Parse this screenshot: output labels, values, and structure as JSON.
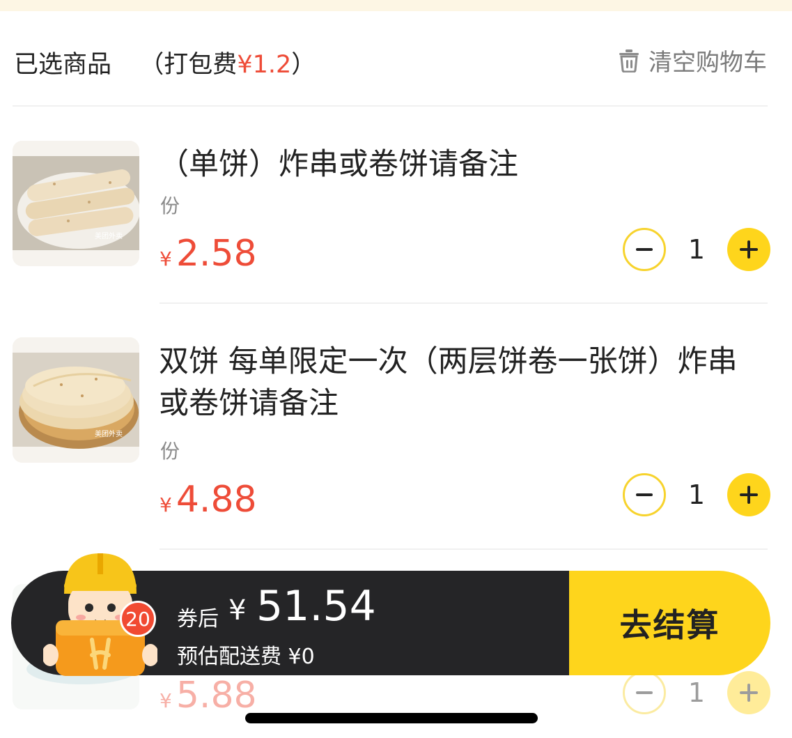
{
  "header": {
    "title": "已选商品",
    "packing_fee_prefix": "（打包费",
    "packing_fee_value": "¥1.2",
    "packing_fee_suffix": "）",
    "clear_cart_label": "清空购物车"
  },
  "items": [
    {
      "name": "（单饼）炸串或卷饼请备注",
      "unit": "份",
      "currency": "¥",
      "price": "2.58",
      "quantity": "1",
      "watermark": "美团外卖"
    },
    {
      "name": "双饼 每单限定一次（两层饼卷一张饼）炸串或卷饼请备注",
      "unit": "份",
      "currency": "¥",
      "price": "4.88",
      "quantity": "1",
      "watermark": "美团外卖"
    },
    {
      "name": "",
      "unit": "",
      "currency": "¥",
      "price": "5.88",
      "quantity": "1"
    }
  ],
  "checkout": {
    "cart_count": "20",
    "after_coupon_label": "券后",
    "total_currency": "¥",
    "total_amount": "51.54",
    "delivery_fee_label": "预估配送费 ¥0",
    "checkout_button_label": "去结算"
  },
  "colors": {
    "price_red": "#ee4c38",
    "accent_yellow": "#fed51c",
    "bar_dark": "#252527"
  }
}
